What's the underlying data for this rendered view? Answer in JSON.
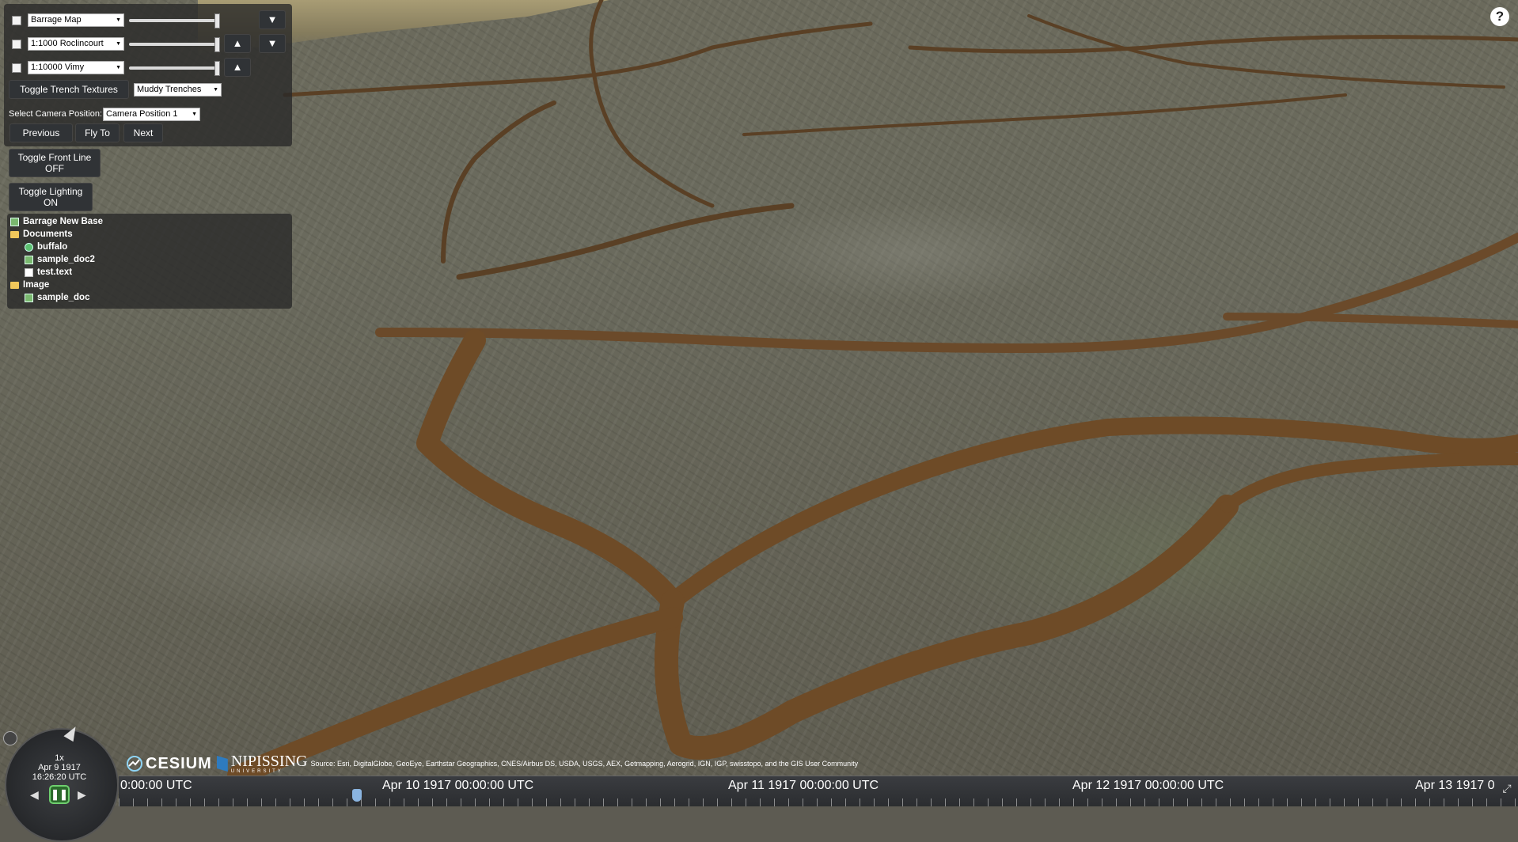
{
  "toolbar": {
    "layers": [
      {
        "name": "Barrage Map",
        "has_up": false,
        "has_down": true,
        "slider": 0.95
      },
      {
        "name": "1:1000 Roclincourt",
        "has_up": true,
        "has_down": true,
        "slider": 0.95
      },
      {
        "name": "1:10000 Vimy",
        "has_up": true,
        "has_down": false,
        "slider": 0.95
      }
    ],
    "up_arrow": "▲",
    "down_arrow": "▼",
    "toggle_textures_label": "Toggle Trench Textures",
    "texture_select": "Muddy Trenches",
    "camera_label": "Select Camera Position:",
    "camera_select": "Camera Position 1",
    "previous_label": "Previous",
    "flyto_label": "Fly To",
    "next_label": "Next"
  },
  "front_line": {
    "label": "Toggle Front Line",
    "state": "OFF"
  },
  "lighting": {
    "label": "Toggle Lighting",
    "state": "ON"
  },
  "tree": [
    {
      "label": "Barrage New Base",
      "icon": "layer-icon",
      "indent": 0
    },
    {
      "label": "Documents",
      "icon": "folder-icon",
      "indent": 0
    },
    {
      "label": "buffalo",
      "icon": "globe-icon",
      "indent": 1
    },
    {
      "label": "sample_doc2",
      "icon": "layer-icon",
      "indent": 1
    },
    {
      "label": "test.text",
      "icon": "document-icon",
      "indent": 1
    },
    {
      "label": "Image",
      "icon": "folder-icon",
      "indent": 0
    },
    {
      "label": "sample_doc",
      "icon": "layer-icon",
      "indent": 1
    }
  ],
  "help_label": "?",
  "animation": {
    "speed": "1x",
    "date": "Apr 9 1917",
    "time": "16:26:20 UTC"
  },
  "timeline": {
    "labels": [
      "0:00:00 UTC",
      "Apr 10 1917 00:00:00 UTC",
      "Apr 11 1917 00:00:00 UTC",
      "Apr 12 1917 00:00:00 UTC",
      "Apr 13 1917 0"
    ]
  },
  "credits": {
    "cesium": "CESIUM",
    "nipissing": "NIPISSING",
    "nipissing_sub": "UNIVERSITY",
    "source": "Source: Esri, DigitalGlobe, GeoEye, Earthstar Geographics, CNES/Airbus DS, USDA, USGS, AEX, Getmapping, Aerogrid, IGN, IGP, swisstopo, and the GIS User Community"
  }
}
